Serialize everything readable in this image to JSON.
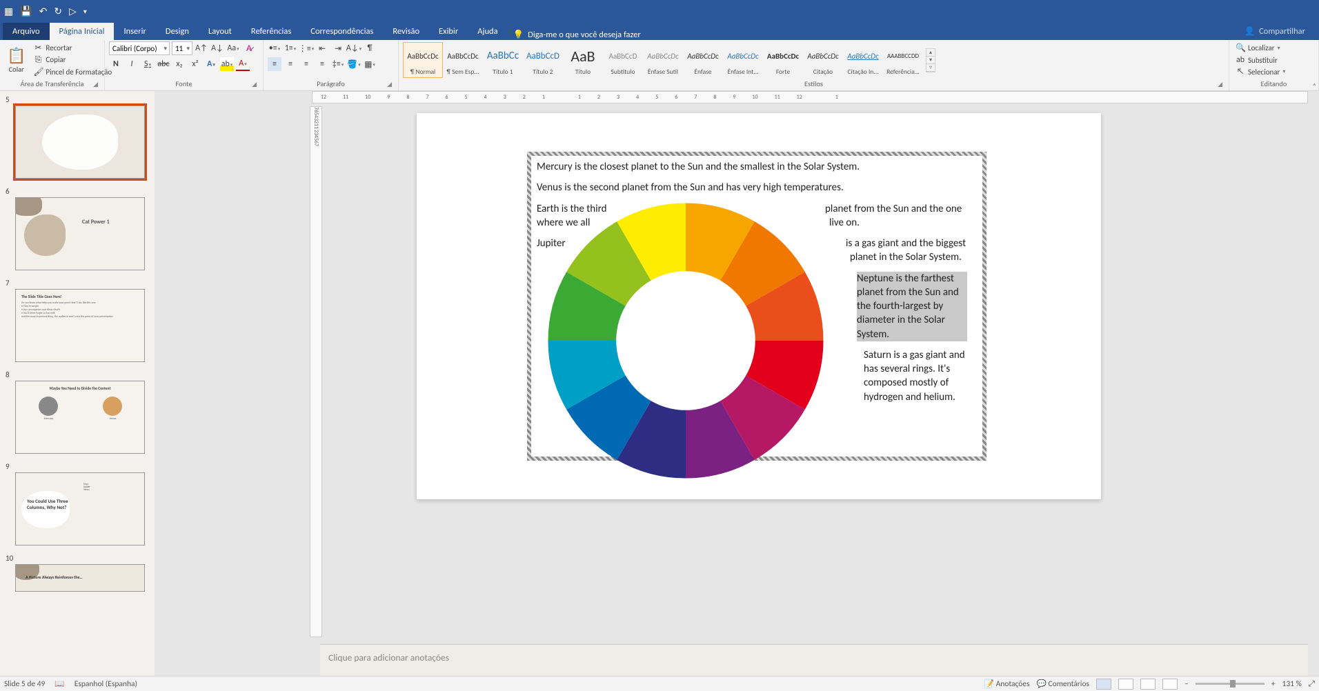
{
  "qat": {
    "save": "💾",
    "undo": "↶",
    "redo": "↻",
    "start": "▷"
  },
  "tabs": [
    "Arquivo",
    "Página Inicial",
    "Inserir",
    "Design",
    "Layout",
    "Referências",
    "Correspondências",
    "Revisão",
    "Exibir",
    "Ajuda"
  ],
  "active_tab": 1,
  "tell_me": "Diga-me o que você deseja fazer",
  "share": "Compartilhar",
  "clipboard": {
    "paste": "Colar",
    "cut": "Recortar",
    "copy": "Copiar",
    "format_painter": "Pincel de Formatação",
    "group_label": "Área de Transferência"
  },
  "font": {
    "name": "Calibri (Corpo)",
    "size": "11",
    "group_label": "Fonte"
  },
  "paragraph": {
    "group_label": "Parágrafo"
  },
  "styles": {
    "group_label": "Estilos",
    "items": [
      {
        "preview": "AaBbCcDc",
        "name": "¶ Normal",
        "sel": true
      },
      {
        "preview": "AaBbCcDc",
        "name": "¶ Sem Esp..."
      },
      {
        "preview": "AaBbCc",
        "name": "Título 1",
        "color": "#2e74b5",
        "size": "15px"
      },
      {
        "preview": "AaBbCcD",
        "name": "Título 2",
        "color": "#2e74b5",
        "size": "13px"
      },
      {
        "preview": "AaB",
        "name": "Título",
        "size": "22px"
      },
      {
        "preview": "AaBbCcD",
        "name": "Subtítulo",
        "color": "#888"
      },
      {
        "preview": "AaBbCcDc",
        "name": "Ênfase Sutil",
        "style": "italic",
        "color": "#888"
      },
      {
        "preview": "AaBbCcDc",
        "name": "Ênfase",
        "style": "italic"
      },
      {
        "preview": "AaBbCcDc",
        "name": "Ênfase Int...",
        "style": "italic",
        "color": "#2e74b5"
      },
      {
        "preview": "AaBbCcDc",
        "name": "Forte",
        "weight": "bold"
      },
      {
        "preview": "AaBbCcDc",
        "name": "Citação",
        "style": "italic"
      },
      {
        "preview": "AaBbCcDc",
        "name": "Citação In...",
        "style": "italic",
        "color": "#2e74b5",
        "underline": true
      },
      {
        "preview": "AAABBCCDD",
        "name": "Referência...",
        "size": "9px"
      }
    ]
  },
  "editing": {
    "find": "Localizar",
    "replace": "Substituir",
    "select": "Selecionar",
    "group_label": "Editando"
  },
  "ruler_h": [
    "12",
    "11",
    "10",
    "9",
    "8",
    "7",
    "6",
    "5",
    "4",
    "3",
    "2",
    "1",
    "",
    "1",
    "2",
    "3",
    "4",
    "5",
    "6",
    "7",
    "8",
    "9",
    "10",
    "11",
    "12",
    "",
    "1"
  ],
  "ruler_v": [
    "7",
    "6",
    "5",
    "4",
    "3",
    "2",
    "1",
    "",
    "1",
    "2",
    "3",
    "4",
    "5",
    "6",
    "7"
  ],
  "slide_text": {
    "mercury": "Mercury is the closest planet to the Sun and the smallest in the Solar System.",
    "venus": "Venus is the second planet from the Sun and has very high temperatures.",
    "earth_a": "Earth is the third",
    "earth_b": "planet from the Sun and the one",
    "earth_c": "where we all",
    "earth_d": "live on.",
    "jupiter_a": "Jupiter",
    "jupiter_b": "is a gas giant and the biggest",
    "jupiter_c": "planet in the Solar System.",
    "neptune": "Neptune is the farthest planet from the Sun and the fourth-largest by diameter in the Solar System.",
    "saturn": "Saturn is a gas giant and has several rings. It's composed mostly of hydrogen and helium."
  },
  "thumbs": {
    "t6_title": "Cat Power 1",
    "t6_sub": "…",
    "t7_title": "The Slide Title Goes Here!",
    "t7_body": "Do you know what helps you make your point clear? Lists like this one.\n• They're simple\n• You can organize your ideas clearly\n• You'll never forget to buy milk\nAnd the most important thing, the audience won't miss the point of your presentation",
    "t8_title": "Maybe You Need to Divide the Content",
    "t8_l": "Mercury",
    "t8_r": "Venus",
    "t9_title": "You Could Use Three Columns, Why Not?",
    "t10_title": "A Picture Always Reinforces the…"
  },
  "notes_placeholder": "Clique para adicionar anotações",
  "status": {
    "slide": "Slide 5 de 49",
    "lang": "Espanhol (Espanha)",
    "notes": "Anotações",
    "comments": "Comentários",
    "zoom": "131 %"
  }
}
